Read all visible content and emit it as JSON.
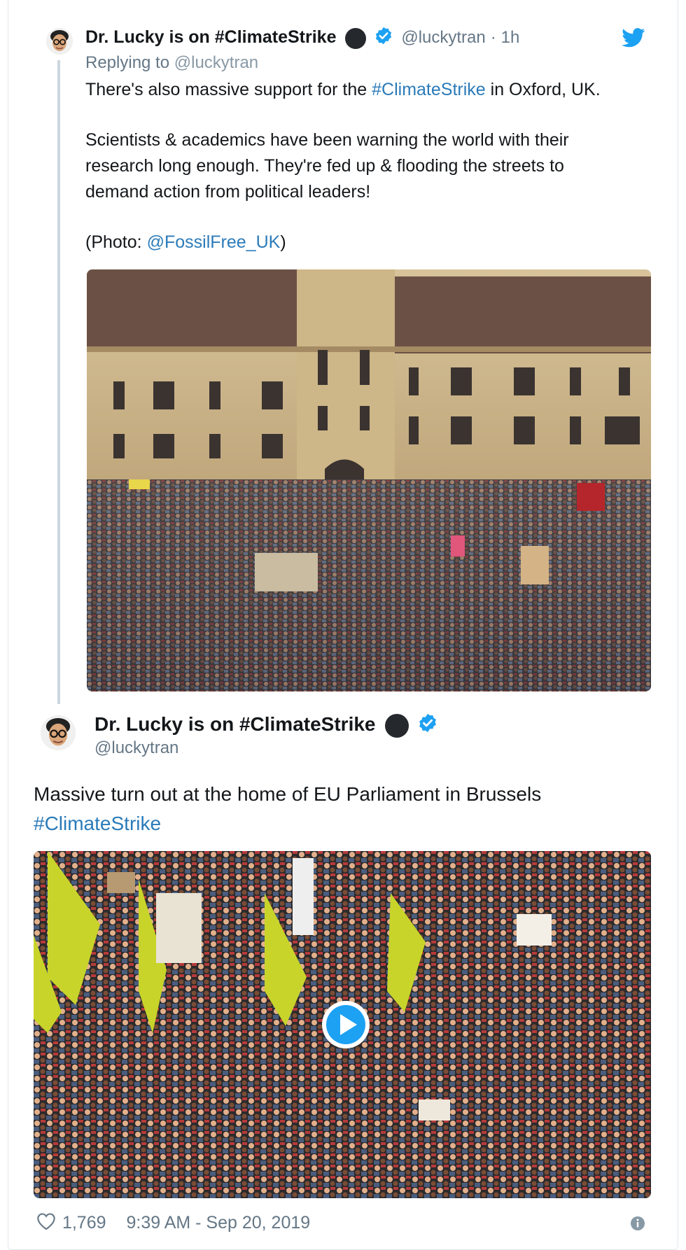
{
  "reply_tweet": {
    "author_name": "Dr. Lucky is on #ClimateStrike",
    "handle": "@luckytran",
    "separator": "·",
    "time_ago": "1h",
    "replying_prefix": "Replying to",
    "replying_handle": "@luckytran",
    "line1_prefix": "There's also massive support for the",
    "line1_hashtag": "#ClimateStrike",
    "line1_suffix": "in Oxford, UK.",
    "para2_line1": "Scientists & academics have been warning the world with their",
    "para2_line2": "research long enough. They're fed up & flooding the streets to",
    "para2_line3": "demand action from political leaders!",
    "photo_prefix": "(Photo:",
    "photo_handle": "@FossilFree_UK",
    "photo_suffix": ")"
  },
  "main_tweet": {
    "author_name": "Dr. Lucky is on #ClimateStrike",
    "handle": "@luckytran",
    "text": "Massive turn out at the home of EU Parliament in Brussels",
    "hashtag": "#ClimateStrike"
  },
  "footer": {
    "likes": "1,769",
    "timestamp": "9:39 AM - Sep 20, 2019"
  },
  "icons": {
    "brand": "twitter-bird-icon",
    "verified": "verified-badge-icon",
    "like": "heart-icon",
    "info": "info-icon",
    "play": "play-icon"
  },
  "colors": {
    "link": "#2b7bb9",
    "verified": "#1da1f2",
    "muted": "#657786",
    "text": "#14171a"
  }
}
